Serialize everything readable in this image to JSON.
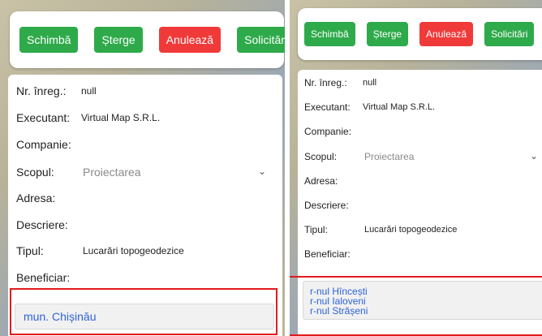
{
  "toolbar": {
    "change_label": "Schimbă",
    "delete_label": "Șterge",
    "cancel_label": "Anulează",
    "requests_label": "Solicitări"
  },
  "form": {
    "nr_label": "Nr. înreg.:",
    "nr_value": "null",
    "executant_label": "Executant:",
    "executant_value": "Virtual Map S.R.L.",
    "companie_label": "Companie:",
    "scopul_label": "Scopul:",
    "scopul_value": "Proiectarea",
    "adresa_label": "Adresa:",
    "descriere_label": "Descriere:",
    "tipul_label": "Tipul:",
    "tipul_value": "Lucarări topogeodezice",
    "beneficiar_label": "Beneficiar:"
  },
  "left_locations": [
    "mun. Chișinău"
  ],
  "right_locations": [
    "r-nul Hîncești",
    "r-nul Ialoveni",
    "r-nul Strășeni"
  ],
  "colors": {
    "green": "#2eaa4a",
    "red": "#f03a3a",
    "link": "#2d63d8",
    "highlight": "#e11c1c"
  },
  "icons": {
    "dropdown": "chevron-down-icon"
  }
}
